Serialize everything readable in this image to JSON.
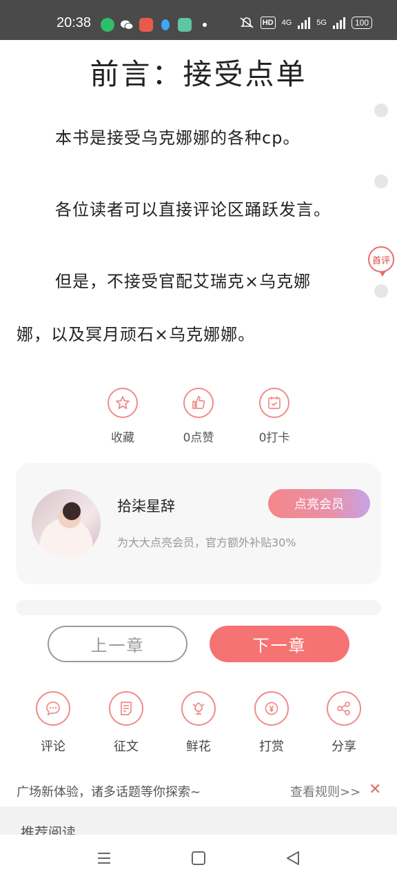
{
  "status_bar": {
    "time": "20:38",
    "network_hd": "HD",
    "net_4g": "4G",
    "net_5g": "5G",
    "battery": "100",
    "app_icons": [
      "video-app-icon",
      "wechat-icon",
      "game-app-icon",
      "qq-icon",
      "reader-app-icon"
    ]
  },
  "chapter": {
    "title": "前言：接受点单",
    "paragraphs": [
      "本书是接受乌克娜娜的各种cp。",
      "各位读者可以直接评论区踊跃发言。",
      "但是，不接受官配艾瑞克×乌克娜",
      "娜，以及冥月顽石×乌克娜娜。"
    ],
    "first_comment_badge": "首评"
  },
  "reactions": {
    "favorite": "收藏",
    "likes": "0点赞",
    "checkins": "0打卡"
  },
  "author": {
    "name": "拾柒星辞",
    "subtitle": "为大大点亮会员，官方额外补贴30%",
    "vip_button": "点亮会员"
  },
  "nav": {
    "prev": "上一章",
    "next": "下一章"
  },
  "actions": [
    "评论",
    "征文",
    "鲜花",
    "打赏",
    "分享"
  ],
  "banner": {
    "text": "广场新体验，诸多话题等你探索~",
    "link": "查看规则>>",
    "close": "✕"
  },
  "recommend": "推荐阅读",
  "colors": {
    "accent": "#f67373",
    "icon_stroke": "#f08a8a",
    "status_bar": "#4a4a4a"
  }
}
